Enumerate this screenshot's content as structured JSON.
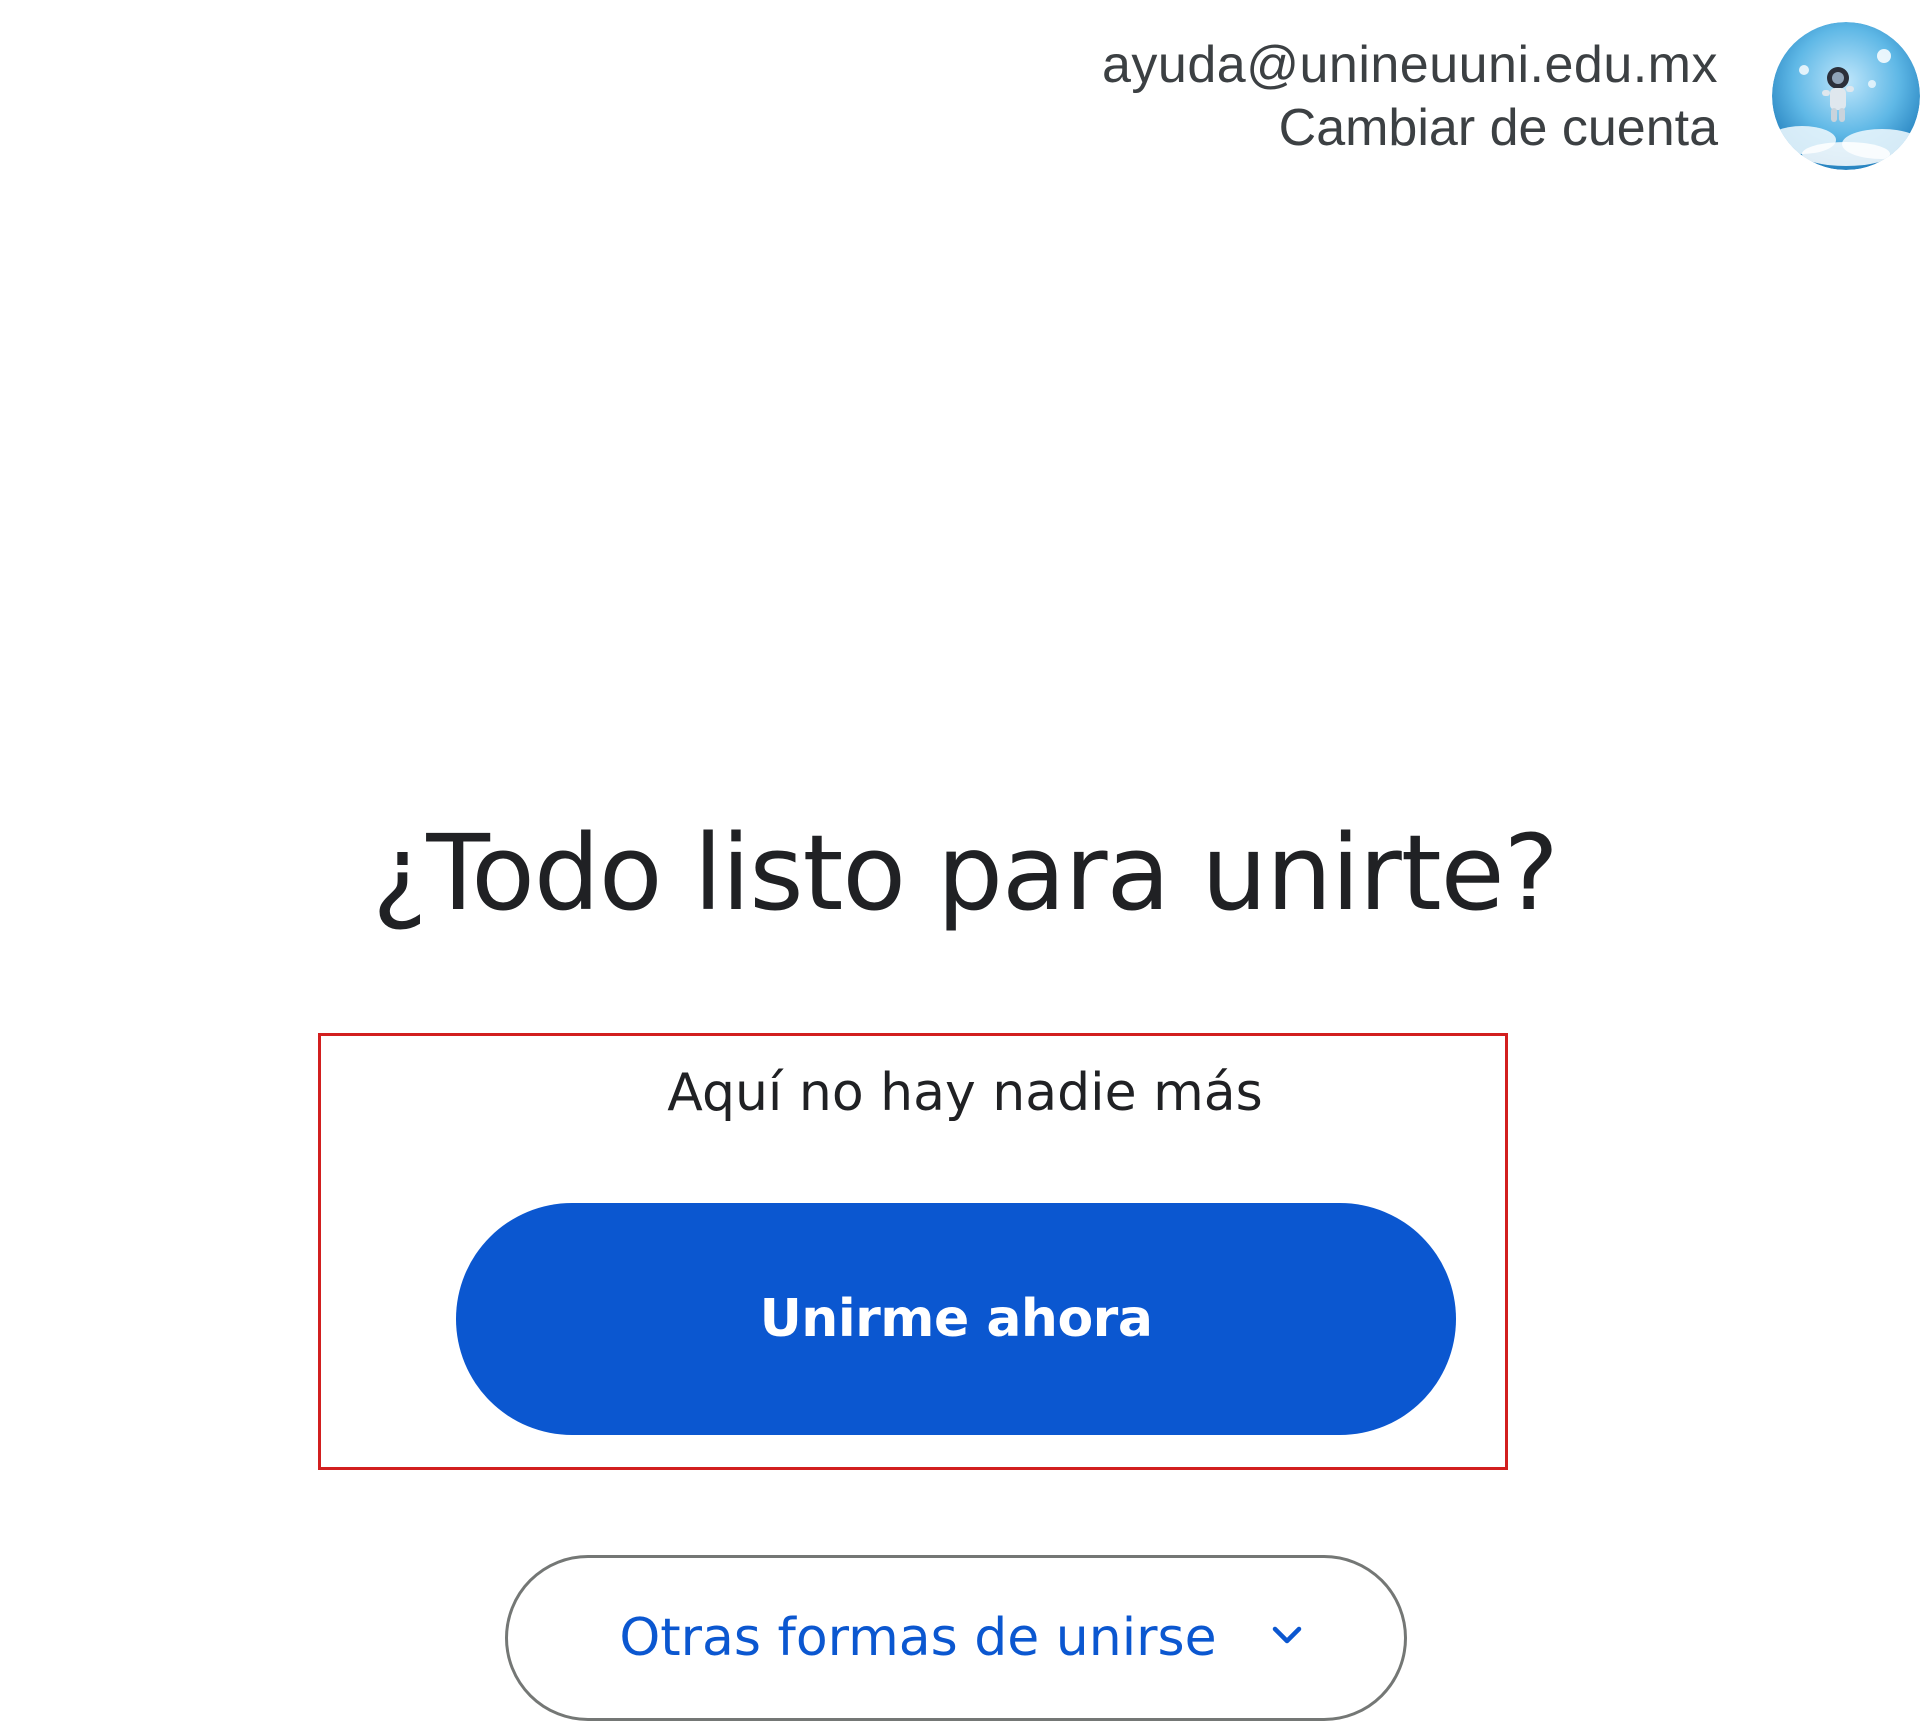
{
  "account": {
    "email": "ayuda@unineuuni.edu.mx",
    "switch_label": "Cambiar de cuenta",
    "avatar_icon": "astronaut-avatar-icon"
  },
  "main": {
    "title": "¿Todo listo para unirte?",
    "status": "Aquí no hay nadie más",
    "join_label": "Unirme ahora",
    "other_label": "Otras formas de unirse",
    "other_icon": "chevron-down-icon"
  },
  "colors": {
    "primary": "#0b57d0",
    "highlight_border": "#d21f1f",
    "outline": "#747775",
    "text": "#202124"
  }
}
